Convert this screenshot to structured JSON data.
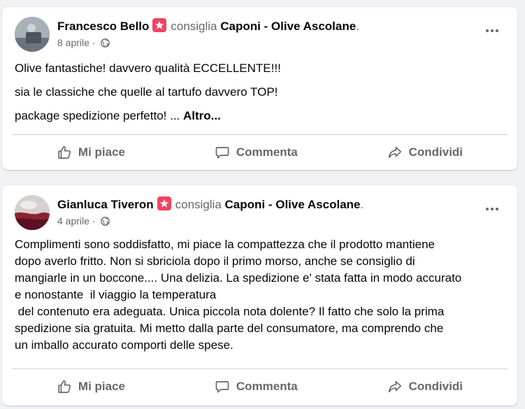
{
  "posts": [
    {
      "author": "Francesco Bello",
      "verb": "consiglia",
      "page": "Caponi - Olive Ascolane",
      "date": "8 aprile",
      "date_separator": "·",
      "body": [
        "Olive fantastiche! davvero qualità ECCELLENTE!!!",
        "sia le classiche che quelle al tartufo davvero TOP!",
        "package spedizione perfetto! ..."
      ],
      "more_label": "Altro..."
    },
    {
      "author": "Gianluca Tiveron",
      "verb": "consiglia",
      "page": "Caponi - Olive Ascolane",
      "date": "4 aprile",
      "date_separator": "·",
      "body_lines": [
        "Complimenti sono soddisfatto, mi piace la compattezza che il prodotto mantiene",
        "dopo averlo fritto. Non si sbriciola dopo il primo morso, anche se consiglio di",
        "mangiarle in un boccone.... Una delizia. La spedizione e' stata fatta in modo accurato",
        "e nonostante  il viaggio la temperatura",
        " del contenuto era adeguata. Unica piccola nota dolente? Il fatto che solo la prima",
        "spedizione sia gratuita. Mi metto dalla parte del consumatore, ma comprendo che",
        "un imballo accurato comporti delle spese."
      ]
    }
  ],
  "actions": {
    "like": "Mi piace",
    "comment": "Commenta",
    "share": "Condividi"
  },
  "icons": {
    "recommend": "recommend-star-icon",
    "globe": "globe-icon",
    "more": "more-options-icon",
    "like": "thumbs-up-icon",
    "comment": "comment-bubble-icon",
    "share": "share-arrow-icon"
  },
  "colors": {
    "recommend_badge": "#f3425f",
    "secondary_text": "#65676b",
    "primary_text": "#050505",
    "background": "#f0f2f5"
  }
}
